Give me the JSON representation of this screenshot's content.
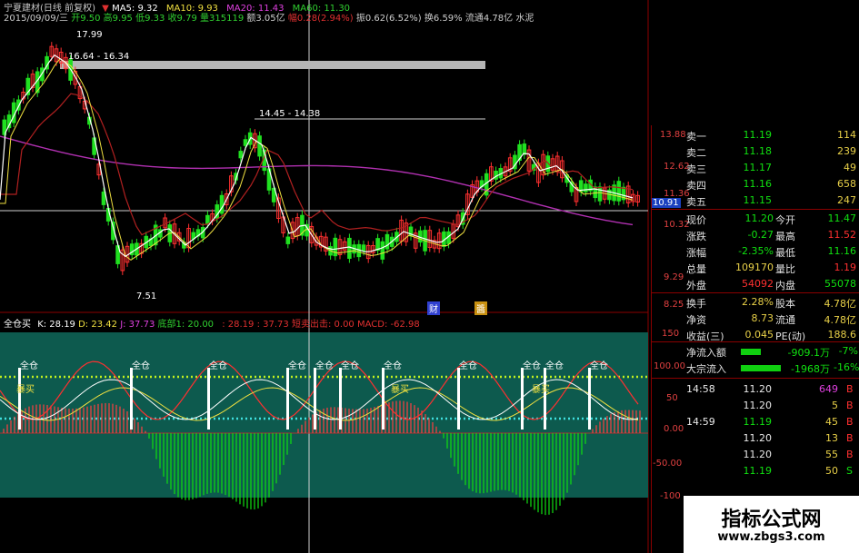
{
  "header": {
    "line1": "宁夏建材(日线 前复权)",
    "ma5": "MA5: 9.32",
    "ma10": "MA10: 9.93",
    "ma20": "MA20: 11.43",
    "ma60": "MA60: 11.30",
    "date": "2015/09/09/三",
    "open": "开9.50",
    "high": "高9.95",
    "low": "低9.33",
    "close": "收9.79",
    "volume": "量315119",
    "amount": "额3.05亿",
    "change_pct": "幅0.28(2.94%)",
    "amplitude": "振0.62(6.52%)",
    "turnover": "换6.59%",
    "float_cap": "流通4.78亿",
    "sector": "水泥"
  },
  "annotations": {
    "peak": "17.99",
    "band1": "16.64 - 16.34",
    "band2": "14.45 - 14.38",
    "low": "7.51",
    "cai": "财",
    "mini": "醬"
  },
  "price_axis": {
    "ticks": [
      "13.88",
      "12.62",
      "11.36",
      "10.32",
      "9.29",
      "8.25"
    ],
    "current": "10.91"
  },
  "indicator": {
    "name": "全仓买",
    "k": "K: 28.19",
    "d": "D: 23.42",
    "j": "J: 37.73",
    "bottom": "底部1: 20.00",
    "v1": ": 28.19",
    "v2": ": 37.73",
    "exit": "短卖出击: 0.00",
    "macd": "MACD: -62.98",
    "label_full": "全仓",
    "label_buy": "暴买",
    "ticks": [
      "150",
      "100.00",
      "50",
      "0.00",
      "-50.00",
      "-100"
    ]
  },
  "quote": {
    "sell": [
      {
        "label": "卖一",
        "price": "11.19",
        "vol": "114"
      },
      {
        "label": "卖二",
        "price": "11.18",
        "vol": "239"
      },
      {
        "label": "卖三",
        "price": "11.17",
        "vol": "49"
      },
      {
        "label": "卖四",
        "price": "11.16",
        "vol": "658"
      },
      {
        "label": "卖五",
        "price": "11.15",
        "vol": "247"
      }
    ],
    "stats": [
      {
        "l1": "现价",
        "v1": "11.20",
        "l2": "今开",
        "v2": "11.47"
      },
      {
        "l1": "涨跌",
        "v1": "-0.27",
        "l2": "最高",
        "v2": "11.52"
      },
      {
        "l1": "涨幅",
        "v1": "-2.35%",
        "l2": "最低",
        "v2": "11.16"
      },
      {
        "l1": "总量",
        "v1": "109170",
        "l2": "量比",
        "v2": "1.19"
      },
      {
        "l1": "外盘",
        "v1": "54092",
        "l2": "内盘",
        "v2": "55078"
      }
    ],
    "stats2": [
      {
        "l1": "换手",
        "v1": "2.28%",
        "l2": "股本",
        "v2": "4.78亿"
      },
      {
        "l1": "净资",
        "v1": "8.73",
        "l2": "流通",
        "v2": "4.78亿"
      },
      {
        "l1": "收益(三)",
        "v1": "0.045",
        "l2": "PE(动)",
        "v2": "188.6"
      }
    ],
    "flows": [
      {
        "label": "净流入额",
        "value": "-909.1万",
        "pct": "-7%"
      },
      {
        "label": "大宗流入",
        "value": "-1968万",
        "pct": "-16%"
      }
    ],
    "ticks": [
      {
        "time": "14:58",
        "price": "11.20",
        "vol": "649",
        "dir": "B"
      },
      {
        "time": "",
        "price": "11.20",
        "vol": "5",
        "dir": "B"
      },
      {
        "time": "14:59",
        "price": "11.19",
        "vol": "45",
        "dir": "B"
      },
      {
        "time": "",
        "price": "11.20",
        "vol": "13",
        "dir": "B"
      },
      {
        "time": "",
        "price": "11.20",
        "vol": "55",
        "dir": "B"
      },
      {
        "time": "",
        "price": "11.19",
        "vol": "50",
        "dir": "S"
      }
    ]
  },
  "watermark": {
    "title": "指标公式网",
    "url": "www.zbgs3.com"
  }
}
